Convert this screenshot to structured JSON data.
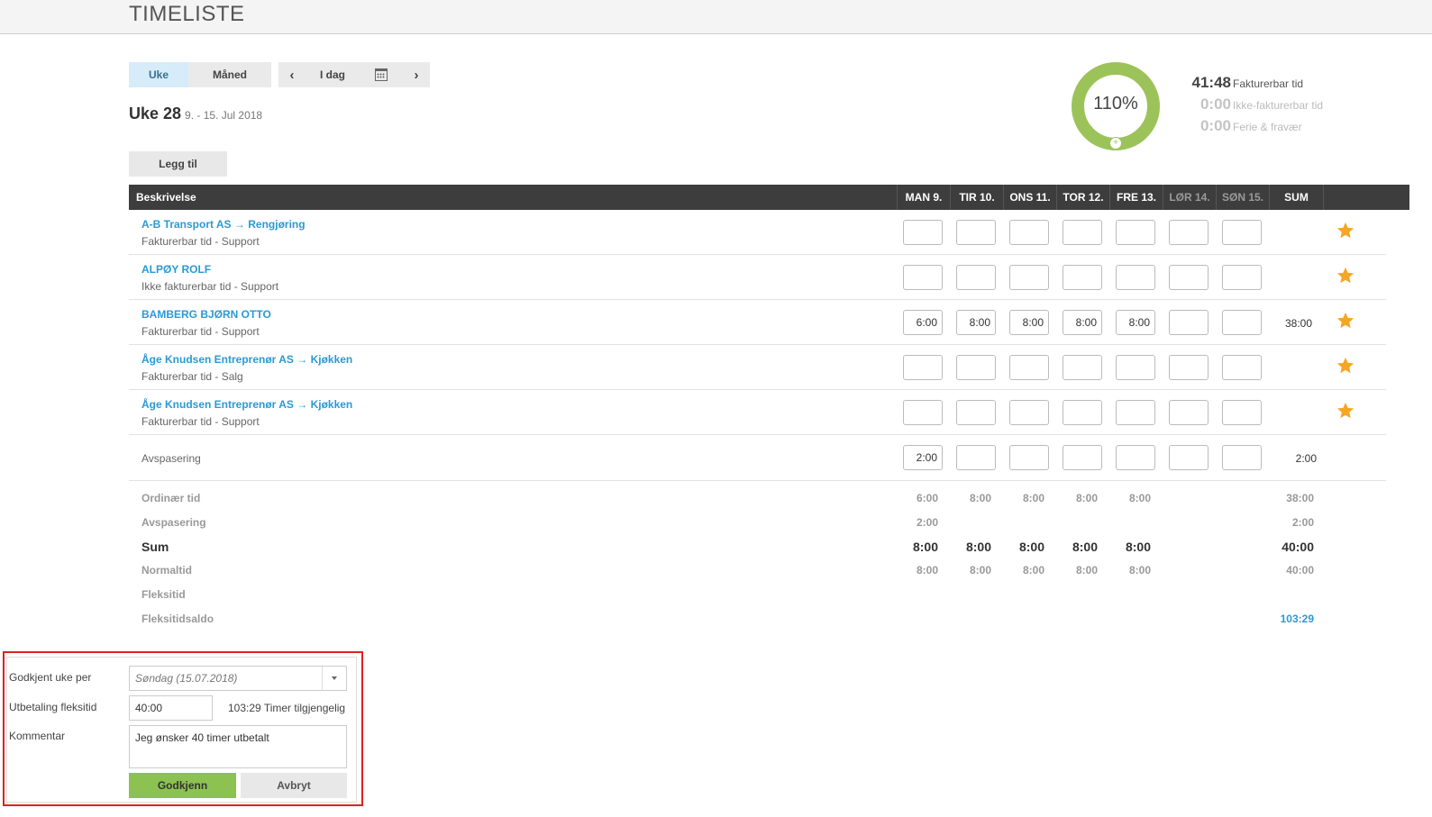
{
  "header": {
    "title": "TIMELISTE"
  },
  "toolbar": {
    "view_week": "Uke",
    "view_month": "Måned",
    "prev": "‹",
    "today": "I dag",
    "next": "›",
    "add_label": "Legg til"
  },
  "week": {
    "title": "Uke 28",
    "range": "9. - 15. Jul 2018"
  },
  "donut": {
    "percent_label": "110%",
    "percent_value": 110,
    "plus": "+",
    "color": "#9cc35a",
    "track_color": "#e3eed4"
  },
  "stats": [
    {
      "value": "41:48",
      "label": "Fakturerbar tid"
    },
    {
      "value": "0:00",
      "label": "Ikke-fakturerbar tid"
    },
    {
      "value": "0:00",
      "label": "Ferie & fravær"
    }
  ],
  "table": {
    "description_header": "Beskrivelse",
    "days": [
      "MAN 9.",
      "TIR 10.",
      "ONS 11.",
      "TOR 12.",
      "FRE 13.",
      "LØR 14.",
      "SØN 15."
    ],
    "sum_header": "SUM",
    "rows": [
      {
        "title": "A-B Transport AS → Rengjøring",
        "subtitle": "Fakturerbar tid - Support",
        "values": [
          "",
          "",
          "",
          "",
          "",
          "",
          ""
        ],
        "sum": ""
      },
      {
        "title": "ALPØY ROLF",
        "subtitle": "Ikke fakturerbar tid - Support",
        "values": [
          "",
          "",
          "",
          "",
          "",
          "",
          ""
        ],
        "sum": ""
      },
      {
        "title": "BAMBERG BJØRN OTTO",
        "subtitle": "Fakturerbar tid - Support",
        "values": [
          "6:00",
          "8:00",
          "8:00",
          "8:00",
          "8:00",
          "",
          ""
        ],
        "sum": "38:00"
      },
      {
        "title": "Åge Knudsen Entreprenør AS → Kjøkken",
        "subtitle": "Fakturerbar tid - Salg",
        "values": [
          "",
          "",
          "",
          "",
          "",
          "",
          ""
        ],
        "sum": ""
      },
      {
        "title": "Åge Knudsen Entreprenør AS → Kjøkken",
        "subtitle": "Fakturerbar tid - Support",
        "values": [
          "",
          "",
          "",
          "",
          "",
          "",
          ""
        ],
        "sum": ""
      }
    ],
    "absence_row": {
      "label": "Avspasering",
      "values": [
        "2:00",
        "",
        "",
        "",
        "",
        "",
        ""
      ],
      "sum": "2:00"
    },
    "star_color": "#f5a623"
  },
  "summary": [
    {
      "label": "Ordinær tid",
      "values": [
        "6:00",
        "8:00",
        "8:00",
        "8:00",
        "8:00",
        "",
        ""
      ],
      "sum": "38:00"
    },
    {
      "label": "Avspasering",
      "values": [
        "2:00",
        "",
        "",
        "",
        "",
        "",
        ""
      ],
      "sum": "2:00"
    },
    {
      "label": "Sum",
      "values": [
        "8:00",
        "8:00",
        "8:00",
        "8:00",
        "8:00",
        "",
        ""
      ],
      "sum": "40:00"
    },
    {
      "label": "Normaltid",
      "values": [
        "8:00",
        "8:00",
        "8:00",
        "8:00",
        "8:00",
        "",
        ""
      ],
      "sum": "40:00"
    },
    {
      "label": "Fleksitid",
      "values": [
        "",
        "",
        "",
        "",
        "",
        "",
        ""
      ],
      "sum": ""
    },
    {
      "label": "Fleksitidsaldo",
      "values": [
        "",
        "",
        "",
        "",
        "",
        "",
        ""
      ],
      "sum": "103:29"
    }
  ],
  "approval": {
    "approved_label": "Godkjent uke per",
    "approved_value": "Søndag (15.07.2018)",
    "payout_label": "Utbetaling fleksitid",
    "payout_value": "40:00",
    "available_value": "103:29",
    "available_label": "Timer tilgjengelig",
    "comment_label": "Kommentar",
    "comment_value": "Jeg ønsker 40 timer utbetalt",
    "approve_button": "Godkjenn",
    "cancel_button": "Avbryt",
    "approve_color": "#8cc251",
    "highlight_color": "#e02020"
  }
}
